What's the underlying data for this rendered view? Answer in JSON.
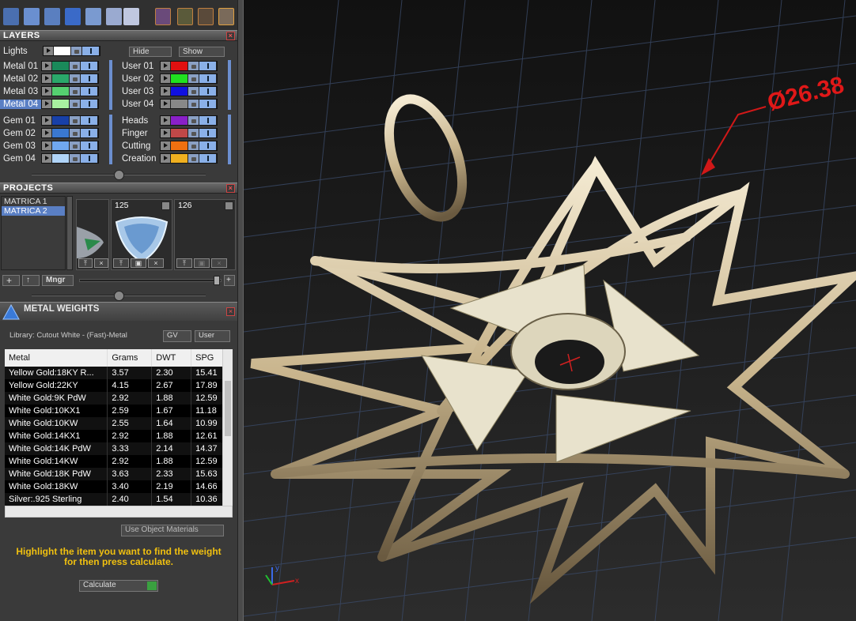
{
  "layers": {
    "title": "LAYERS",
    "lights_label": "Lights",
    "hide_label": "Hide",
    "show_label": "Show",
    "left": [
      {
        "name": "Metal 01",
        "color": "#1a8a5a",
        "selected": false
      },
      {
        "name": "Metal 02",
        "color": "#2aa86a",
        "selected": false
      },
      {
        "name": "Metal 03",
        "color": "#55d070",
        "selected": false
      },
      {
        "name": "Metal 04",
        "color": "#a8f0a0",
        "selected": true
      },
      {
        "name": "Gem 01",
        "color": "#1840a8",
        "selected": false
      },
      {
        "name": "Gem 02",
        "color": "#3a78d0",
        "selected": false
      },
      {
        "name": "Gem 03",
        "color": "#70a8f0",
        "selected": false
      },
      {
        "name": "Gem 04",
        "color": "#b0d4f8",
        "selected": false
      }
    ],
    "right": [
      {
        "name": "User 01",
        "color": "#e01010"
      },
      {
        "name": "User 02",
        "color": "#20e020"
      },
      {
        "name": "User 03",
        "color": "#1010e0"
      },
      {
        "name": "User 04",
        "color": "#888888"
      },
      {
        "name": "Heads",
        "color": "#8a20c8"
      },
      {
        "name": "Finger",
        "color": "#c04848"
      },
      {
        "name": "Cutting",
        "color": "#f07010"
      },
      {
        "name": "Creation",
        "color": "#f0b020"
      }
    ]
  },
  "projects": {
    "title": "PROJECTS",
    "items": [
      "MATRICA 1",
      "MATRICA 2"
    ],
    "thumb_numbers": [
      "125",
      "126"
    ],
    "mngr_label": "Mngr"
  },
  "metal_weights": {
    "title": "METAL WEIGHTS",
    "library": "Library: Cutout White - (Fast)-Metal",
    "gv_label": "GV",
    "user_label": "User",
    "columns": [
      "Metal",
      "Grams",
      "DWT",
      "SPG"
    ],
    "rows": [
      [
        "Yellow Gold:18KY R...",
        "3.57",
        "2.30",
        "15.41"
      ],
      [
        "Yellow Gold:22KY",
        "4.15",
        "2.67",
        "17.89"
      ],
      [
        "White Gold:9K PdW",
        "2.92",
        "1.88",
        "12.59"
      ],
      [
        "White Gold:10KX1",
        "2.59",
        "1.67",
        "11.18"
      ],
      [
        "White Gold:10KW",
        "2.55",
        "1.64",
        "10.99"
      ],
      [
        "White Gold:14KX1",
        "2.92",
        "1.88",
        "12.61"
      ],
      [
        "White Gold:14K PdW",
        "3.33",
        "2.14",
        "14.37"
      ],
      [
        "White Gold:14KW",
        "2.92",
        "1.88",
        "12.59"
      ],
      [
        "White Gold:18K PdW",
        "3.63",
        "2.33",
        "15.63"
      ],
      [
        "White Gold:18KW",
        "3.40",
        "2.19",
        "14.66"
      ],
      [
        "Silver:.925 Sterling",
        "2.40",
        "1.54",
        "10.36"
      ]
    ],
    "use_object_materials": "Use Object Materials",
    "hint_line1": "Highlight the item you want to find the weight",
    "hint_line2": "for then press calculate.",
    "calculate_label": "Calculate"
  },
  "viewport": {
    "dimension_text": "Ø26.38",
    "axis_x": "x",
    "axis_y": "y"
  }
}
